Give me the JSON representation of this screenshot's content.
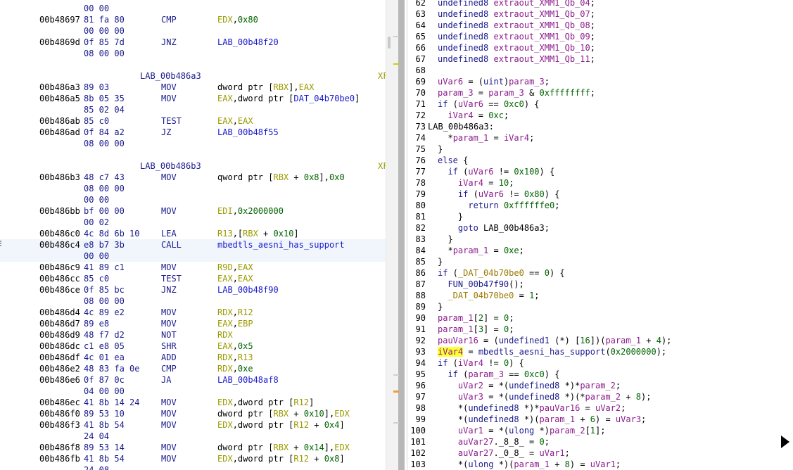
{
  "listing": {
    "rows": [
      {
        "bytes": "00 00"
      },
      {
        "addr": "00b48697",
        "bytes": "81 fa 80",
        "mnemonic": "CMP",
        "operand": "EDX,0x80"
      },
      {
        "bytes": "00 00 00"
      },
      {
        "addr": "00b4869d",
        "bytes": "0f 85 7d",
        "mnemonic": "JNZ",
        "operand": "LAB_00b48f20"
      },
      {
        "bytes": "08 00 00"
      },
      {},
      {
        "label": "LAB_00b486a3",
        "xref": "XF"
      },
      {
        "addr": "00b486a3",
        "bytes": "89 03",
        "mnemonic": "MOV",
        "operand": "dword ptr [RBX],EAX"
      },
      {
        "addr": "00b486a5",
        "bytes": "8b 05 35",
        "mnemonic": "MOV",
        "operand": "EAX,dword ptr [DAT_04b70be0]"
      },
      {
        "bytes": "85 02 04"
      },
      {
        "addr": "00b486ab",
        "bytes": "85 c0",
        "mnemonic": "TEST",
        "operand": "EAX,EAX"
      },
      {
        "addr": "00b486ad",
        "bytes": "0f 84 a2",
        "mnemonic": "JZ",
        "operand": "LAB_00b48f55"
      },
      {
        "bytes": "08 00 00"
      },
      {},
      {
        "label": "LAB_00b486b3",
        "xref": "XF"
      },
      {
        "addr": "00b486b3",
        "bytes": "48 c7 43",
        "mnemonic": "MOV",
        "operand": "qword ptr [RBX + 0x8],0x0"
      },
      {
        "bytes": "08 00 00"
      },
      {
        "bytes": "00 00"
      },
      {
        "addr": "00b486bb",
        "bytes": "bf 00 00",
        "mnemonic": "MOV",
        "operand": "EDI,0x2000000"
      },
      {
        "bytes": "00 02"
      },
      {
        "addr": "00b486c0",
        "bytes": "4c 8d 6b 10",
        "mnemonic": "LEA",
        "operand": "R13,[RBX + 0x10]"
      },
      {
        "addr": "00b486c4",
        "bytes": "e8 b7 3b",
        "mnemonic": "CALL",
        "operand": "mbedtls_aesni_has_support",
        "selected": true
      },
      {
        "bytes": "00 00",
        "selected": true
      },
      {
        "addr": "00b486c9",
        "bytes": "41 89 c1",
        "mnemonic": "MOV",
        "operand": "R9D,EAX"
      },
      {
        "addr": "00b486cc",
        "bytes": "85 c0",
        "mnemonic": "TEST",
        "operand": "EAX,EAX"
      },
      {
        "addr": "00b486ce",
        "bytes": "0f 85 bc",
        "mnemonic": "JNZ",
        "operand": "LAB_00b48f90"
      },
      {
        "bytes": "08 00 00"
      },
      {
        "addr": "00b486d4",
        "bytes": "4c 89 e2",
        "mnemonic": "MOV",
        "operand": "RDX,R12"
      },
      {
        "addr": "00b486d7",
        "bytes": "89 e8",
        "mnemonic": "MOV",
        "operand": "EAX,EBP"
      },
      {
        "addr": "00b486d9",
        "bytes": "48 f7 d2",
        "mnemonic": "NOT",
        "operand": "RDX"
      },
      {
        "addr": "00b486dc",
        "bytes": "c1 e8 05",
        "mnemonic": "SHR",
        "operand": "EAX,0x5"
      },
      {
        "addr": "00b486df",
        "bytes": "4c 01 ea",
        "mnemonic": "ADD",
        "operand": "RDX,R13"
      },
      {
        "addr": "00b486e2",
        "bytes": "48 83 fa 0e",
        "mnemonic": "CMP",
        "operand": "RDX,0xe"
      },
      {
        "addr": "00b486e6",
        "bytes": "0f 87 0c",
        "mnemonic": "JA",
        "operand": "LAB_00b48af8"
      },
      {
        "bytes": "04 00 00"
      },
      {
        "addr": "00b486ec",
        "bytes": "41 8b 14 24",
        "mnemonic": "MOV",
        "operand": "EDX,dword ptr [R12]"
      },
      {
        "addr": "00b486f0",
        "bytes": "89 53 10",
        "mnemonic": "MOV",
        "operand": "dword ptr [RBX + 0x10],EDX"
      },
      {
        "addr": "00b486f3",
        "bytes": "41 8b 54",
        "mnemonic": "MOV",
        "operand": "EDX,dword ptr [R12 + 0x4]"
      },
      {
        "bytes": "24 04"
      },
      {
        "addr": "00b486f8",
        "bytes": "89 53 14",
        "mnemonic": "MOV",
        "operand": "dword ptr [RBX + 0x14],EDX"
      },
      {
        "addr": "00b486fb",
        "bytes": "41 8b 54",
        "mnemonic": "MOV",
        "operand": "EDX,dword ptr [R12 + 0x8]"
      },
      {
        "bytes": "24 08"
      }
    ]
  },
  "decompiler": {
    "lines": [
      {
        "n": "62",
        "text": "undefined8 extraout_XMM1_Qb_04;"
      },
      {
        "n": "63",
        "text": "undefined8 extraout_XMM1_Qb_07;"
      },
      {
        "n": "64",
        "text": "undefined8 extraout_XMM1_Qb_08;"
      },
      {
        "n": "65",
        "text": "undefined8 extraout_XMM1_Qb_09;"
      },
      {
        "n": "66",
        "text": "undefined8 extraout_XMM1_Qb_10;"
      },
      {
        "n": "67",
        "text": "undefined8 extraout_XMM1_Qb_11;"
      },
      {
        "n": "68",
        "text": ""
      },
      {
        "n": "69",
        "text": "uVar6 = (uint)param_3;"
      },
      {
        "n": "70",
        "text": "param_3 = param_3 & 0xffffffff;"
      },
      {
        "n": "71",
        "text": "if (uVar6 == 0xc0) {"
      },
      {
        "n": "72",
        "text": "  iVar4 = 0xc;"
      },
      {
        "n": "73",
        "text": "LAB_00b486a3:",
        "outdent": true
      },
      {
        "n": "74",
        "text": "  *param_1 = iVar4;"
      },
      {
        "n": "75",
        "text": "}"
      },
      {
        "n": "76",
        "text": "else {"
      },
      {
        "n": "77",
        "text": "  if (uVar6 != 0x100) {"
      },
      {
        "n": "78",
        "text": "    iVar4 = 10;"
      },
      {
        "n": "79",
        "text": "    if (uVar6 != 0x80) {"
      },
      {
        "n": "80",
        "text": "      return 0xffffffe0;"
      },
      {
        "n": "81",
        "text": "    }"
      },
      {
        "n": "82",
        "text": "    goto LAB_00b486a3;"
      },
      {
        "n": "83",
        "text": "  }"
      },
      {
        "n": "84",
        "text": "  *param_1 = 0xe;"
      },
      {
        "n": "85",
        "text": "}"
      },
      {
        "n": "86",
        "text": "if (_DAT_04b70be0 == 0) {"
      },
      {
        "n": "87",
        "text": "  FUN_00b47f90();"
      },
      {
        "n": "88",
        "text": "  _DAT_04b70be0 = 1;"
      },
      {
        "n": "89",
        "text": "}"
      },
      {
        "n": "90",
        "text": "param_1[2] = 0;"
      },
      {
        "n": "91",
        "text": "param_1[3] = 0;"
      },
      {
        "n": "92",
        "text": "pauVar16 = (undefined1 (*) [16])(param_1 + 4);"
      },
      {
        "n": "93",
        "text": "iVar4 = mbedtls_aesni_has_support(0x2000000);",
        "highlight": "iVar4"
      },
      {
        "n": "94",
        "text": "if (iVar4 != 0) {"
      },
      {
        "n": "95",
        "text": "  if (param_3 == 0xc0) {"
      },
      {
        "n": "96",
        "text": "    uVar2 = *(undefined8 *)*param_2;"
      },
      {
        "n": "97",
        "text": "    uVar3 = *(undefined8 *)(*param_2 + 8);"
      },
      {
        "n": "98",
        "text": "    *(undefined8 *)*pauVar16 = uVar2;"
      },
      {
        "n": "99",
        "text": "    *(undefined8 *)(param_1 + 6) = uVar3;"
      },
      {
        "n": "100",
        "text": "    uVar1 = *(ulong *)param_2[1];"
      },
      {
        "n": "101",
        "text": "    auVar27._8_8_ = 0;"
      },
      {
        "n": "102",
        "text": "    auVar27._0_8_ = uVar1;"
      },
      {
        "n": "103",
        "text": "    *(ulong *)(param_1 + 8) = uVar1;"
      }
    ]
  },
  "colors": {
    "selected_row": "#f0f6fc",
    "token_highlight": "#ffff33",
    "scroll_marker_orange": "#f0a030",
    "scroll_marker_yellow": "#d0d000"
  },
  "icons": [
    "mouse-cursor-icon"
  ]
}
